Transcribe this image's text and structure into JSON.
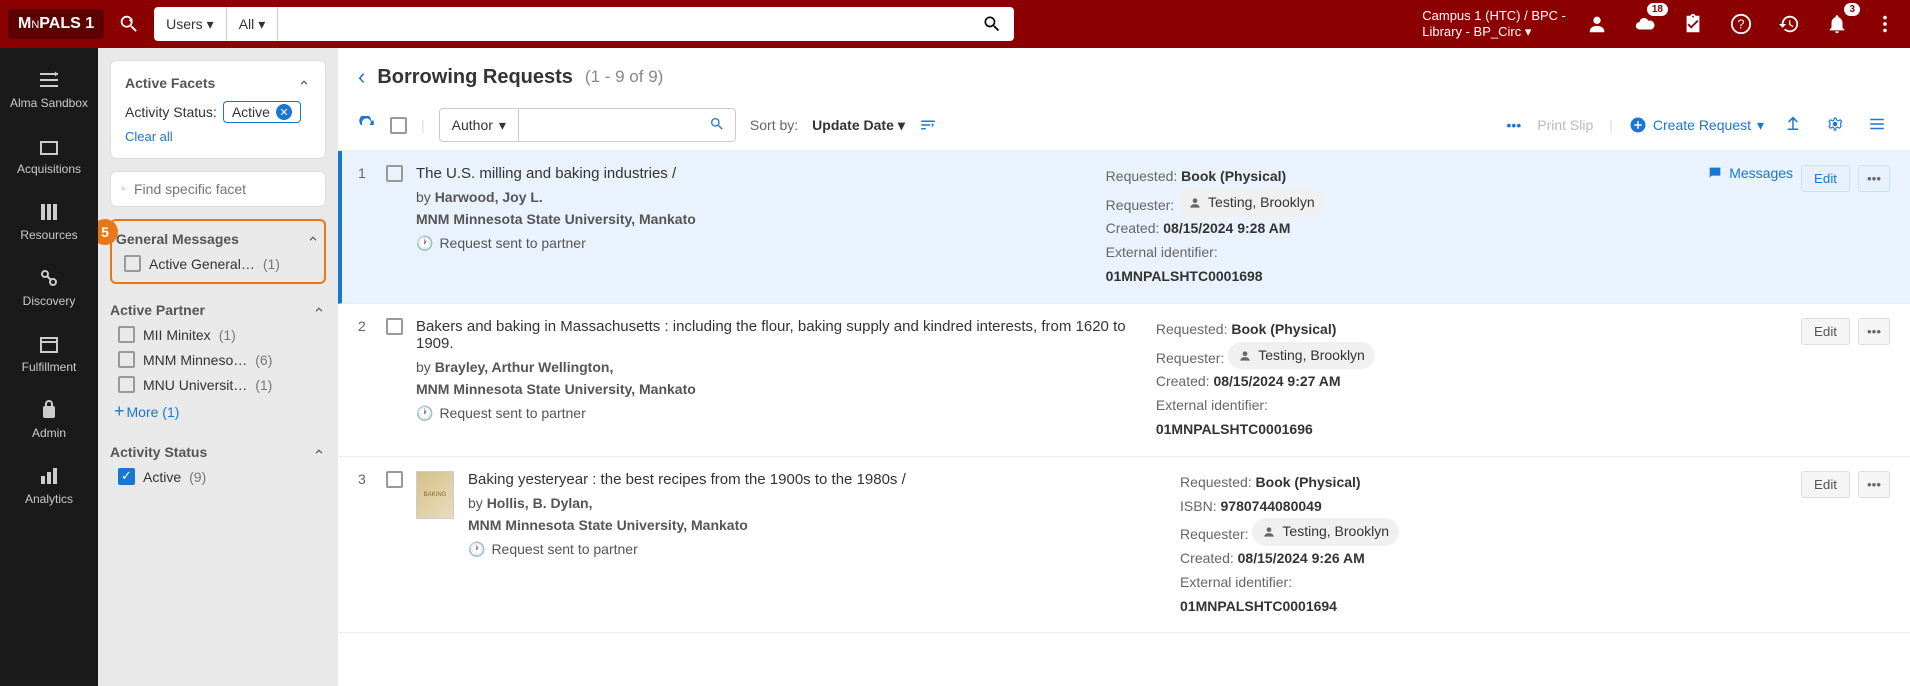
{
  "logo": {
    "name": "MNPALS 1"
  },
  "search": {
    "scope1": "Users",
    "scope2": "All",
    "placeholder": ""
  },
  "campus": {
    "line1": "Campus 1 (HTC) / BPC -",
    "line2": "Library - BP_Circ"
  },
  "badges": {
    "cloud": "18",
    "bell": "3"
  },
  "nav": [
    {
      "label": "Alma Sandbox"
    },
    {
      "label": "Acquisitions"
    },
    {
      "label": "Resources"
    },
    {
      "label": "Discovery"
    },
    {
      "label": "Fulfillment"
    },
    {
      "label": "Admin"
    },
    {
      "label": "Analytics"
    }
  ],
  "facets": {
    "active_title": "Active Facets",
    "activity_status_label": "Activity Status:",
    "activity_status_chip": "Active",
    "clear_all": "Clear all",
    "search_placeholder": "Find specific facet",
    "groups": {
      "general_messages": {
        "title": "General Messages",
        "items": [
          {
            "label": "Active General…",
            "count": "(1)"
          }
        ]
      },
      "active_partner": {
        "title": "Active Partner",
        "items": [
          {
            "label": "MII Minitex",
            "count": "(1)"
          },
          {
            "label": "MNM Minneso…",
            "count": "(6)"
          },
          {
            "label": "MNU Universit…",
            "count": "(1)"
          }
        ],
        "more": "More (1)"
      },
      "activity_status": {
        "title": "Activity Status",
        "items": [
          {
            "label": "Active",
            "count": "(9)",
            "checked": true
          }
        ]
      }
    }
  },
  "callout_number": "5",
  "page": {
    "title": "Borrowing Requests",
    "range": "(1 - 9 of 9)"
  },
  "toolbar": {
    "author_dropdown": "Author",
    "sort_label": "Sort by:",
    "sort_value": "Update Date",
    "print_slip": "Print Slip",
    "create_request": "Create Request"
  },
  "rows": [
    {
      "idx": "1",
      "selected": true,
      "title": "The U.S. milling and baking industries /",
      "by_prefix": "by ",
      "author": "Harwood, Joy L.",
      "institution": "MNM Minnesota State University, Mankato",
      "status": "Request sent to partner",
      "requested_lbl": "Requested:",
      "requested_val": "Book (Physical)",
      "requester_lbl": "Requester:",
      "requester_val": "Testing, Brooklyn",
      "created_lbl": "Created:",
      "created_val": "08/15/2024 9:28 AM",
      "ext_lbl": "External identifier:",
      "ext_val": "01MNPALSHTC0001698",
      "messages": "Messages",
      "edit": "Edit"
    },
    {
      "idx": "2",
      "title": "Bakers and baking in Massachusetts : including the flour, baking supply and kindred interests, from 1620 to 1909.",
      "by_prefix": "by ",
      "author": "Brayley, Arthur Wellington,",
      "institution": "MNM Minnesota State University, Mankato",
      "status": "Request sent to partner",
      "requested_lbl": "Requested:",
      "requested_val": "Book (Physical)",
      "requester_lbl": "Requester:",
      "requester_val": "Testing, Brooklyn",
      "created_lbl": "Created:",
      "created_val": "08/15/2024 9:27 AM",
      "ext_lbl": "External identifier:",
      "ext_val": "01MNPALSHTC0001696",
      "edit": "Edit"
    },
    {
      "idx": "3",
      "has_thumb": true,
      "title": "Baking yesteryear : the best recipes from the 1900s to the 1980s /",
      "by_prefix": "by ",
      "author": "Hollis, B. Dylan,",
      "institution": "MNM Minnesota State University, Mankato",
      "status": "Request sent to partner",
      "requested_lbl": "Requested:",
      "requested_val": "Book (Physical)",
      "isbn_lbl": "ISBN:",
      "isbn_val": "9780744080049",
      "requester_lbl": "Requester:",
      "requester_val": "Testing, Brooklyn",
      "created_lbl": "Created:",
      "created_val": "08/15/2024 9:26 AM",
      "ext_lbl": "External identifier:",
      "ext_val": "01MNPALSHTC0001694",
      "edit": "Edit"
    }
  ]
}
